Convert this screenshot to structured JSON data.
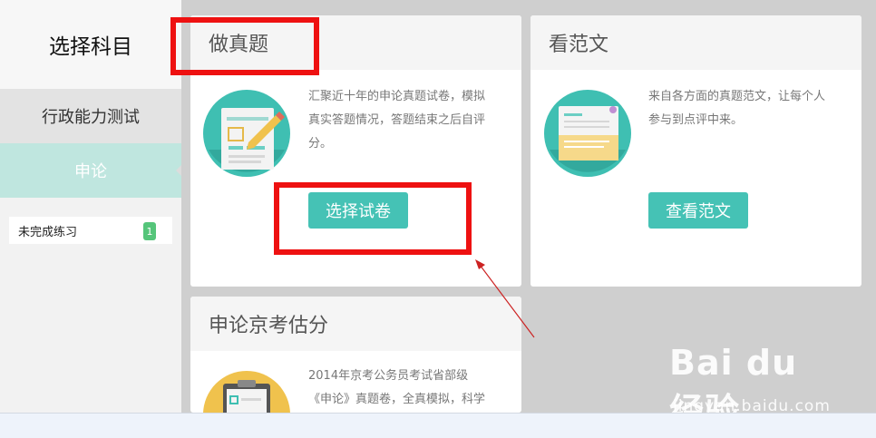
{
  "sidebar": {
    "title": "选择科目",
    "items": [
      {
        "label": "行政能力测试"
      },
      {
        "label": "申论"
      }
    ],
    "unfinished": {
      "label": "未完成练习",
      "count": "1"
    }
  },
  "cards": [
    {
      "title": "做真题",
      "description_lines": [
        "汇聚近十年的申论真题试卷，模拟",
        "真实答题情况，答题结束之后自评",
        "分。"
      ],
      "button_label": "选择试卷"
    },
    {
      "title": "看范文",
      "description_lines": [
        "来自各方面的真题范文，让每个人",
        "参与到点评中来。"
      ],
      "button_label": "查看范文"
    },
    {
      "title": "申论京考估分",
      "description_lines": [
        "2014年京考公务员考试省部级",
        "《申论》真题卷，全真模拟，科学"
      ]
    }
  ],
  "watermark": {
    "main": "Bai du 经验",
    "sub": "jingyan.baidu.com"
  },
  "colors": {
    "accent": "#45c2b5",
    "highlight": "#e11111",
    "selected": "#bfe6df"
  }
}
